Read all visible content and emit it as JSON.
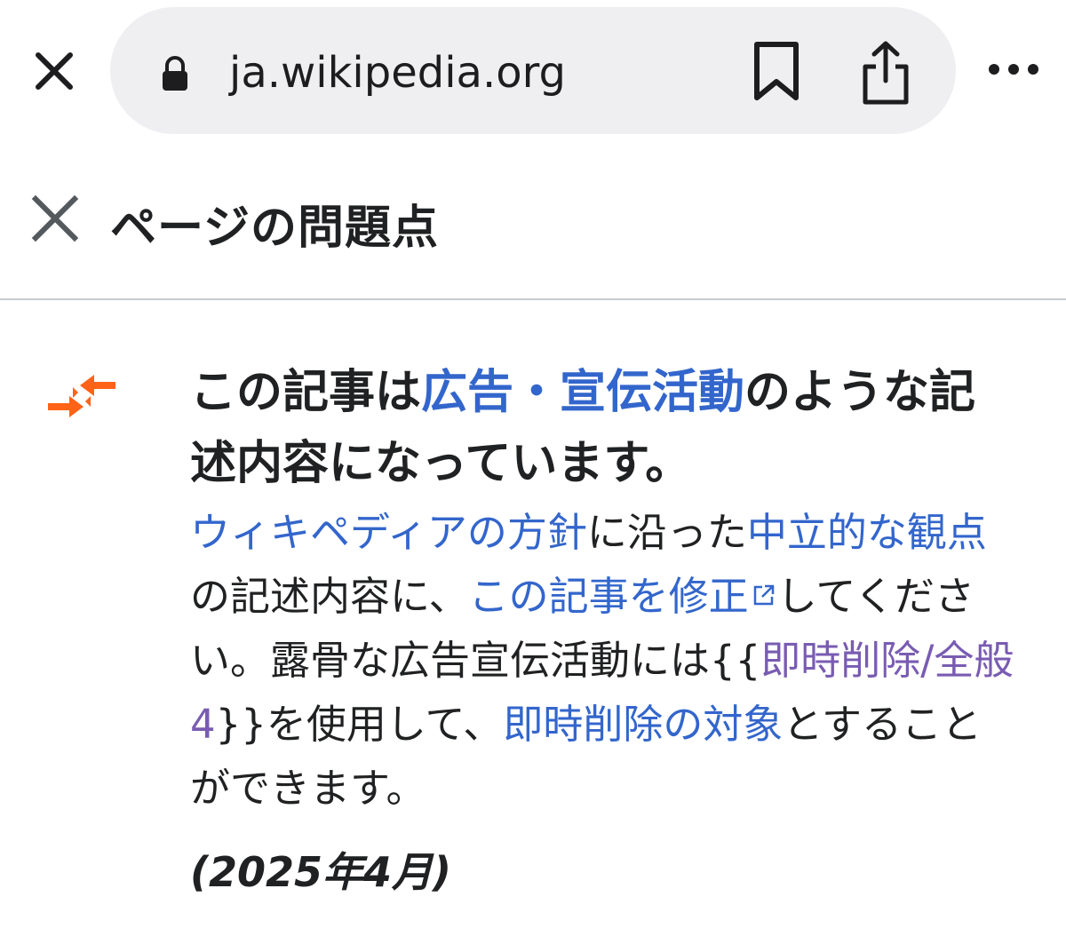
{
  "browser": {
    "url": "ja.wikipedia.org",
    "icons": {
      "close": "close-icon",
      "lock": "lock-icon",
      "bookmark": "bookmark-icon",
      "share": "share-icon",
      "more": "more-icon"
    }
  },
  "panel": {
    "title": "ページの問題点",
    "close_icon": "close-icon"
  },
  "notice": {
    "icon": "advertisement-notice-icon",
    "icon_color": "#ff6318",
    "link_color": "#3366cc",
    "visited_link_color": "#795cb2",
    "heading": {
      "pre": "この記事は",
      "link": "広告・宣伝活動",
      "post": "のような記述内容になっています。"
    },
    "body": {
      "link_policy": "ウィキペディアの方針",
      "t1": "に沿った",
      "link_neutral": "中立的な観点",
      "t2": "の記述内容に、",
      "link_edit": "この記事を修正",
      "t3": "してください。露骨な広告宣伝活動には{{",
      "link_template": "即時削除/全般4",
      "t4": "}}を使用して、",
      "link_deletion": "即時削除の対象",
      "t5": "とすることができます。"
    },
    "date": "(2025年4月)"
  }
}
